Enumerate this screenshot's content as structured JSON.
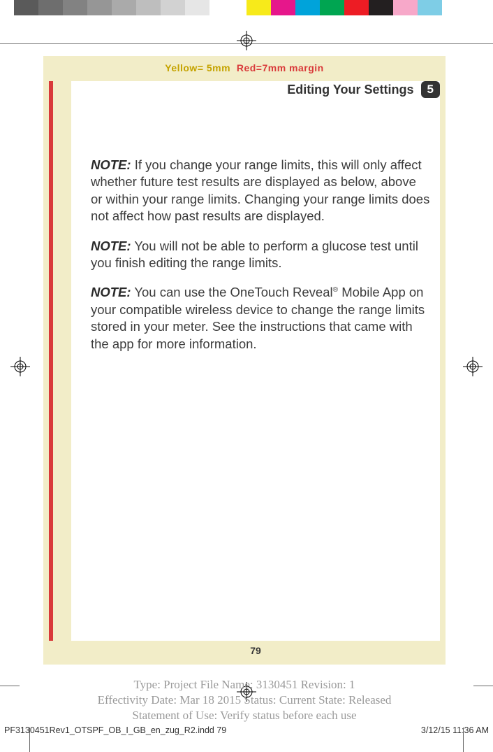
{
  "colorbar": {
    "grays": [
      "#5a5a5a",
      "#6e6e6e",
      "#828282",
      "#969696",
      "#aaaaaa",
      "#bebebe",
      "#d2d2d2",
      "#e6e6e6",
      "#ffffff"
    ],
    "colors": [
      "#f7ea1a",
      "#e6178b",
      "#00a3da",
      "#00a551",
      "#ed1c24",
      "#231f20",
      "#f7a8c9",
      "#7ecde6"
    ]
  },
  "margin_note": {
    "yellow": "Yellow= 5mm",
    "red": "Red=7mm margin"
  },
  "header": {
    "title": "Editing Your Settings",
    "chapter": "5"
  },
  "notes": [
    {
      "label": "NOTE:",
      "text": "If you change your range limits, this will only affect whether future test results are displayed as below, above or within your range limits. Changing your range limits does not affect how past results are displayed."
    },
    {
      "label": "NOTE:",
      "text": "You will not be able to perform a glucose test until you finish editing the range limits."
    },
    {
      "label": "NOTE:",
      "text": "You can use the OneTouch Reveal® Mobile App on your compatible wireless device to change the range limits stored in your meter. See the instructions that came with the app for more information."
    }
  ],
  "page_number": "79",
  "meta": {
    "line1": "Type: Project File  Name: 3130451  Revision: 1",
    "line2": "Effectivity Date: Mar 18 2015     Status: Current     State: Released",
    "line3": "Statement of Use: Verify status before each use"
  },
  "footer": {
    "file": "PF3130451Rev1_OTSPF_OB_I_GB_en_zug_R2.indd   79",
    "timestamp": "3/12/15   11:36 AM"
  }
}
